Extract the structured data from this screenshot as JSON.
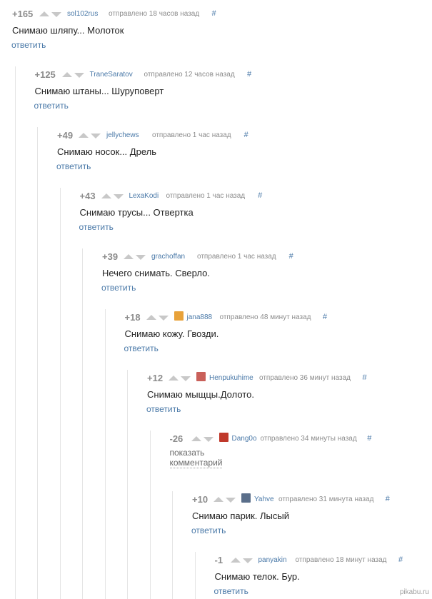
{
  "comments": [
    {
      "rating": "+165",
      "user": "sol102rus",
      "meta": "отправлено 18 часов назад",
      "hash": "#",
      "text": "Снимаю шляпу... Молоток",
      "reply": "ответить"
    },
    {
      "rating": "+125",
      "user": "TraneSaratov",
      "meta": "отправлено 12 часов назад",
      "hash": "#",
      "text": "Снимаю штаны... Шуруповерт",
      "reply": "ответить"
    },
    {
      "rating": "+49",
      "user": "jellychews",
      "meta": "отправлено 1 час назад",
      "hash": "#",
      "text": "Снимаю носок... Дрель",
      "reply": "ответить"
    },
    {
      "rating": "+43",
      "user": "LexaKodi",
      "meta": "отправлено 1 час назад",
      "hash": "#",
      "text": "Снимаю трусы... Отвертка",
      "reply": "ответить"
    },
    {
      "rating": "+39",
      "user": "grachoffan",
      "meta": "отправлено 1 час назад",
      "hash": "#",
      "text": "Нечего снимать. Сверло.",
      "reply": "ответить"
    },
    {
      "rating": "+18",
      "user": "jana888",
      "meta": "отправлено 48 минут назад",
      "hash": "#",
      "text": "Снимаю кожу. Гвозди.",
      "reply": "ответить"
    },
    {
      "rating": "+12",
      "user": "Henpukuhime",
      "meta": "отправлено 36 минут назад",
      "hash": "#",
      "text": "Снимаю мыщцы.Долото.",
      "reply": "ответить"
    },
    {
      "rating": "-26",
      "user": "Dang0o",
      "meta": "отправлено 34 минуты назад",
      "hash": "#",
      "show": "показать комментарий"
    },
    {
      "rating": "+10",
      "user": "Yahve",
      "meta": "отправлено 31 минута назад",
      "hash": "#",
      "text": "Снимаю парик. Лысый",
      "reply": "ответить"
    },
    {
      "rating": "-1",
      "user": "panyakin",
      "meta": "отправлено 18 минут назад",
      "hash": "#",
      "text": "Снимаю телок. Бур.",
      "reply": "ответить"
    }
  ],
  "avatars": {
    "jana888": "#e8a23a",
    "Henpukuhime": "#c9605a",
    "Dang0o": "#c0392b",
    "Yahve": "#5a6e8a"
  },
  "watermark": "pikabu.ru"
}
